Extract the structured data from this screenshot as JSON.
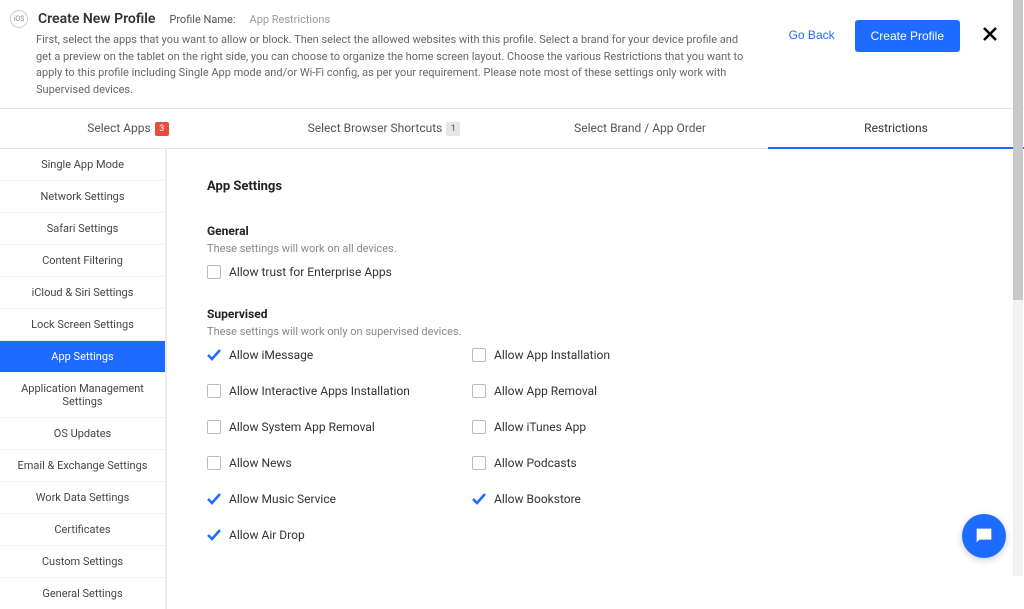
{
  "header": {
    "os_badge": "iOS",
    "title": "Create New Profile",
    "profile_name_label": "Profile Name:",
    "profile_name_value": "App Restrictions",
    "description": "First, select the apps that you want to allow or block. Then select the allowed websites with this profile. Select a brand for your device profile and get a preview on the tablet on the right side, you can choose to organize the home screen layout. Choose the various Restrictions that you want to apply to this profile including Single App mode and/or Wi-Fi config, as per your requirement. Please note most of these settings only work with Supervised devices.",
    "go_back": "Go Back",
    "create": "Create Profile"
  },
  "tabs": [
    {
      "label": "Select Apps",
      "badge": "3",
      "badge_style": "red"
    },
    {
      "label": "Select Browser Shortcuts",
      "badge": "1",
      "badge_style": "grey"
    },
    {
      "label": "Select Brand / App Order"
    },
    {
      "label": "Restrictions",
      "active": true
    }
  ],
  "sidebar": {
    "items": [
      "Single App Mode",
      "Network Settings",
      "Safari Settings",
      "Content Filtering",
      "iCloud & Siri Settings",
      "Lock Screen Settings",
      "App Settings",
      "Application Management Settings",
      "OS Updates",
      "Email & Exchange Settings",
      "Work Data Settings",
      "Certificates",
      "Custom Settings",
      "General Settings"
    ],
    "active_index": 6
  },
  "content": {
    "heading": "App Settings",
    "groups": [
      {
        "title": "General",
        "desc": "These settings will work on all devices.",
        "options": [
          {
            "label": "Allow trust for Enterprise Apps",
            "checked": false
          }
        ]
      },
      {
        "title": "Supervised",
        "desc": "These settings will work only on supervised devices.",
        "options": [
          {
            "label": "Allow iMessage",
            "checked": true
          },
          {
            "label": "Allow App Installation",
            "checked": false
          },
          {
            "label": "Allow Interactive Apps Installation",
            "checked": false
          },
          {
            "label": "Allow App Removal",
            "checked": false
          },
          {
            "label": "Allow System App Removal",
            "checked": false
          },
          {
            "label": "Allow iTunes App",
            "checked": false
          },
          {
            "label": "Allow News",
            "checked": false
          },
          {
            "label": "Allow Podcasts",
            "checked": false
          },
          {
            "label": "Allow Music Service",
            "checked": true
          },
          {
            "label": "Allow Bookstore",
            "checked": true
          },
          {
            "label": "Allow Air Drop",
            "checked": true
          }
        ]
      }
    ]
  }
}
